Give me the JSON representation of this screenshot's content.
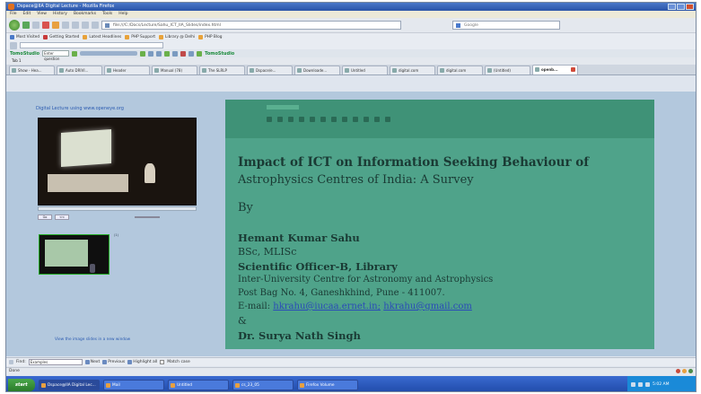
{
  "window": {
    "title": "Dspace@IIA Digital Lecture - Mozilla Firefox"
  },
  "menu": [
    "File",
    "Edit",
    "View",
    "History",
    "Bookmarks",
    "Tools",
    "Help"
  ],
  "nav": {
    "url": "file:///C:/Docs/Lecture/Sahu_ICT_IIA_Slides/index.html",
    "search_placeholder": "Google"
  },
  "bookmarks": [
    {
      "label": "Most Visited",
      "icon": "b"
    },
    {
      "label": "Getting Started",
      "icon": "r"
    },
    {
      "label": "Latest Headlines",
      "icon": ""
    },
    {
      "label": "PHP Support",
      "icon": ""
    },
    {
      "label": "Library @ Delhi",
      "icon": ""
    },
    {
      "label": "PHP Blog",
      "icon": ""
    }
  ],
  "toolbar2": {
    "brand_left": "TomoStudio",
    "select_value": "Enter question",
    "brand_right": "TomoStudio"
  },
  "tab_row_label": "Tab 1",
  "tabs": [
    {
      "label": "Show - Hea..."
    },
    {
      "label": "Auto DRIVI..."
    },
    {
      "label": "Header"
    },
    {
      "label": "Manual (78)"
    },
    {
      "label": "The SLRLP"
    },
    {
      "label": "Dspace/e..."
    },
    {
      "label": "Downloade..."
    },
    {
      "label": "Untitled"
    },
    {
      "label": "digital.com"
    },
    {
      "label": "digital.com"
    },
    {
      "label": "(Untitled)"
    },
    {
      "label": "openb...",
      "active": true
    }
  ],
  "left": {
    "top_link": "Digital Lecture using www.openeye.org",
    "view_link": "View the image slides in a new window",
    "thumb_label": "(1)",
    "ctrl_time": "0:00:00 / 0:45:00",
    "btn1": "Go",
    "btn2": "<<"
  },
  "slide": {
    "title1": "Impact of ICT on Information Seeking Behaviour of",
    "title2": "Astrophysics Centres of India: A Survey",
    "by": "By",
    "author1": "Hemant Kumar Sahu",
    "degree1": "BSc, MLISc",
    "role1": "Scientific Officer-B, Library",
    "inst1": "Inter-University Centre for Astronomy and Astrophysics",
    "addr1": "Post Bag No. 4, Ganeshkhind, Pune - 411007.",
    "email_label": "E-mail:",
    "email1": "hkrahu@iucaa.ernet.in;",
    "email2": "hkrahu@gmail.com",
    "amp": "&",
    "author2": "Dr. Surya Nath Singh"
  },
  "findbar": {
    "label": "Find:",
    "value": "Examples",
    "next": "Next",
    "previous": "Previous",
    "highlight": "Highlight all",
    "match_case": "Match case"
  },
  "status": {
    "text": "Done"
  },
  "taskbar": {
    "start": "start",
    "tasks": [
      {
        "label": "Dspace@IIA Digital Lec..."
      },
      {
        "label": "Mail"
      },
      {
        "label": "Untitled"
      },
      {
        "label": "cs_23_05"
      },
      {
        "label": "Firefox Volume"
      }
    ],
    "clock": "5:02 AM"
  }
}
